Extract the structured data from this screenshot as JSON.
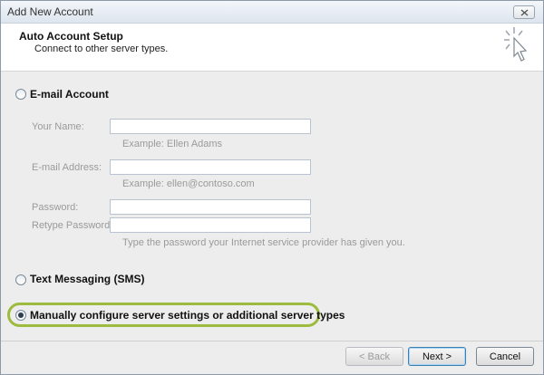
{
  "window": {
    "title": "Add New Account"
  },
  "header": {
    "title": "Auto Account Setup",
    "subtitle": "Connect to other server types."
  },
  "options": {
    "email_account": "E-mail Account",
    "text_messaging": "Text Messaging (SMS)",
    "manual_config": "Manually configure server settings or additional server types",
    "selected": "manual_config"
  },
  "fields": {
    "your_name": {
      "label": "Your Name:",
      "value": "",
      "example": "Example: Ellen Adams"
    },
    "email_address": {
      "label": "E-mail Address:",
      "value": "",
      "example": "Example: ellen@contoso.com"
    },
    "password": {
      "label": "Password:",
      "value": ""
    },
    "retype_password": {
      "label": "Retype Password:",
      "value": ""
    },
    "password_hint": "Type the password your Internet service provider has given you."
  },
  "buttons": {
    "back": "< Back",
    "next": "Next >",
    "cancel": "Cancel"
  },
  "colors": {
    "highlight_ring": "#9dbb3d"
  }
}
